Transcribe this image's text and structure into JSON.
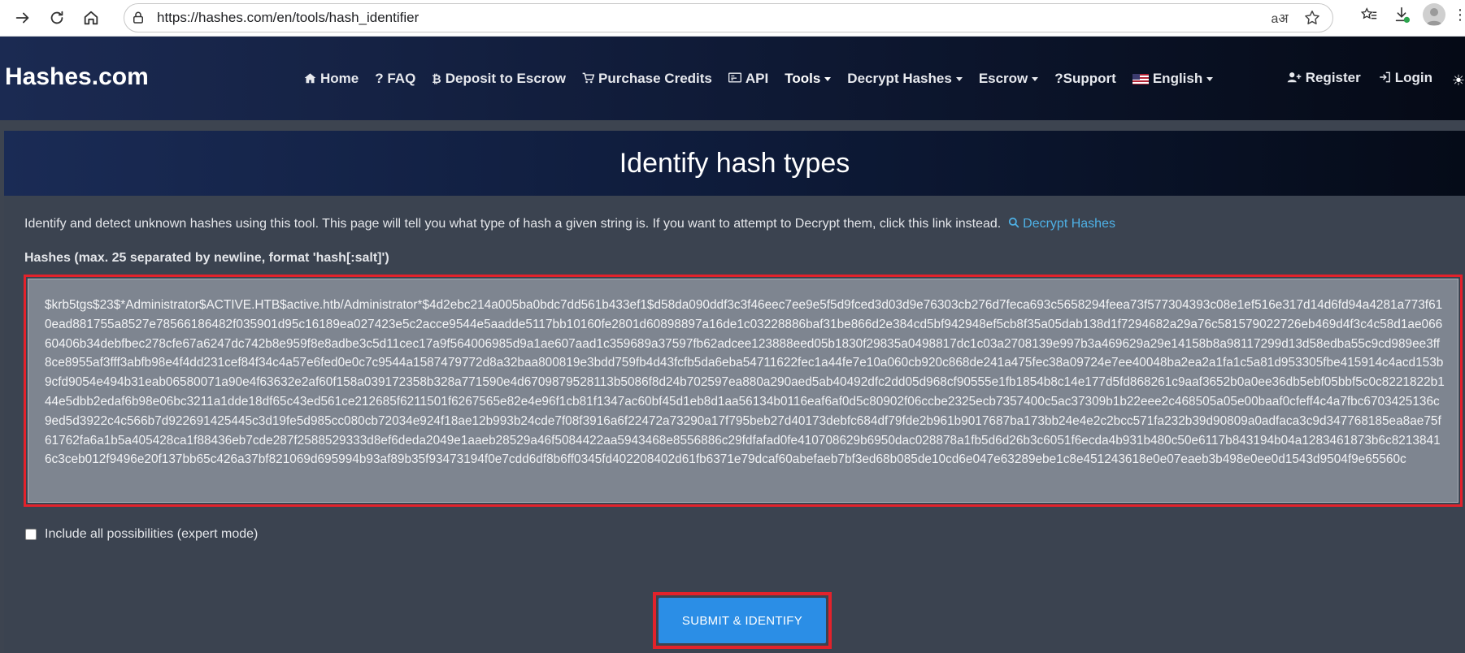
{
  "browser": {
    "url": "https://hashes.com/en/tools/hash_identifier"
  },
  "navbar": {
    "brand": "Hashes.com",
    "items": [
      {
        "label": "Home",
        "icon": "home-icon"
      },
      {
        "label": "? FAQ",
        "icon": ""
      },
      {
        "label": "Deposit to Escrow",
        "icon": "bitcoin-icon"
      },
      {
        "label": "Purchase Credits",
        "icon": "cart-icon"
      },
      {
        "label": "API",
        "icon": "api-icon"
      },
      {
        "label": "Tools",
        "icon": "",
        "dropdown": true,
        "active": true
      },
      {
        "label": "Decrypt Hashes",
        "icon": "",
        "dropdown": true
      },
      {
        "label": "Escrow",
        "icon": "",
        "dropdown": true
      },
      {
        "label": "?Support",
        "icon": ""
      },
      {
        "label": "English",
        "icon": "flag-icon",
        "dropdown": true
      }
    ],
    "register": "Register",
    "login": "Login"
  },
  "main": {
    "title": "Identify hash types",
    "intro": "Identify and detect unknown hashes using this tool. This page will tell you what type of hash a given string is. If you want to attempt to Decrypt them, click this link instead.",
    "intro_link": "Decrypt Hashes",
    "hashes_label": "Hashes (max. 25 separated by newline, format 'hash[:salt]')",
    "hash_value": "$krb5tgs$23$*Administrator$ACTIVE.HTB$active.htb/Administrator*$4d2ebc214a005ba0bdc7dd561b433ef1$d58da090ddf3c3f46eec7ee9e5f5d9fced3d03d9e76303cb276d7feca693c5658294feea73f577304393c08e1ef516e317d14d6fd94a4281a773f610ead881755a8527e78566186482f035901d95c16189ea027423e5c2acce9544e5aadde5117bb10160fe2801d60898897a16de1c03228886baf31be866d2e384cd5bf942948ef5cb8f35a05dab138d1f7294682a29a76c581579022726eb469d4f3c4c58d1ae06660406b34debfbec278cfe67a6247dc742b8e959f8e8adbe3c5d11cec17a9f564006985d9a1ae607aad1c359689a37597fb62adcee123888eed05b1830f29835a0498817dc1c03a2708139e997b3a469629a29e14158b8a98117299d13d58edba55c9cd989ee3ff8ce8955af3fff3abfb98e4f4dd231cef84f34c4a57e6fed0e0c7c9544a1587479772d8a32baa800819e3bdd759fb4d43fcfb5da6eba54711622fec1a44fe7e10a060cb920c868de241a475fec38a09724e7ee40048ba2ea2a1fa1c5a81d953305fbe415914c4acd153b9cfd9054e494b31eab06580071a90e4f63632e2af60f158a039172358b328a771590e4d6709879528113b5086f8d24b702597ea880a290aed5ab40492dfc2dd05d968cf90555e1fb1854b8c14e177d5fd868261c9aaf3652b0a0ee36db5ebf05bbf5c0c8221822b144e5dbb2edaf6b98e06bc3211a1dde18df65c43ed561ce212685f6211501f6267565e82e4e96f1cb81f1347ac60bf45d1eb8d1aa56134b0116eaf6af0d5c80902f06ccbe2325ecb7357400c5ac37309b1b22eee2c468505a05e00baaf0cfeff4c4a7fbc6703425136c9ed5d3922c4c566b7d922691425445c3d19fe5d985cc080cb72034e924f18ae12b993b24cde7f08f3916a6f22472a73290a17f795beb27d40173debfc684df79fde2b961b9017687ba173bb24e4e2c2bcc571fa232b39d90809a0adfaca3c9d347768185ea8ae75f61762fa6a1b5a405428ca1f88436eb7cde287f2588529333d8ef6deda2049e1aaeb28529a46f5084422aa5943468e8556886c29fdfafad0fe410708629b6950dac028878a1fb5d6d26b3c6051f6ecda4b931b480c50e6117b843194b04a1283461873b6c82138416c3ceb012f9496e20f137bb65c426a37bf821069d695994b93af89b35f93473194f0e7cdd6df8b6ff0345fd402208402d61fb6371e79dcaf60abefaeb7bf3ed68b085de10cd6e047e63289ebe1c8e451243618e0e07eaeb3b498e0ee0d1543d9504f9e65560c",
    "expert_mode_label": "Include all possibilities (expert mode)",
    "submit_label": "SUBMIT & IDENTIFY"
  },
  "colors": {
    "accent": "#2b8ee6",
    "highlight": "#e3222b",
    "link": "#4eb1e6"
  }
}
